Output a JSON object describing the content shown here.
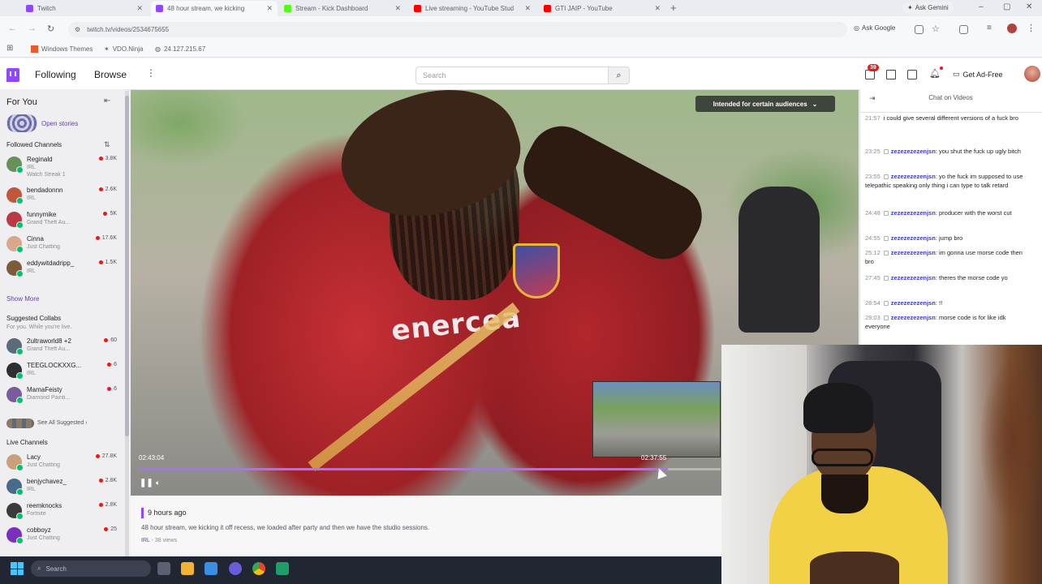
{
  "browser": {
    "tabs": [
      {
        "title": "Twitch",
        "color": "#9146ff",
        "active": false
      },
      {
        "title": "48 hour stream, we kicking",
        "color": "#9146ff",
        "active": true
      },
      {
        "title": "Stream - Kick Dashboard",
        "color": "#53fc18",
        "active": false
      },
      {
        "title": "Live streaming - YouTube Stud",
        "color": "#ff0000",
        "active": false
      },
      {
        "title": "GTI JAIP - YouTube",
        "color": "#ff0000",
        "active": false
      }
    ],
    "gemini_label": "Ask Gemini",
    "url": "twitch.tv/videos/2534675655",
    "ask_google": "Ask Google",
    "bookmarks": [
      "Windows Themes",
      "VDO.Ninja",
      "24.127.215.67"
    ]
  },
  "topnav": {
    "following": "Following",
    "browse": "Browse",
    "search_placeholder": "Search",
    "notifications_count": "39",
    "get_ad_free": "Get Ad-Free"
  },
  "sidebar": {
    "for_you": "For You",
    "open_stories": "Open stories",
    "followed_header": "Followed Channels",
    "followed": [
      {
        "name": "Reginald",
        "game": "IRL",
        "extra": "Watch Streak 1",
        "viewers": "3.8K",
        "color": "#6a8f5a"
      },
      {
        "name": "bendadonnn",
        "game": "IRL",
        "viewers": "2.6K",
        "color": "#c0563e"
      },
      {
        "name": "funnymike",
        "game": "Grand Theft Au...",
        "viewers": "5K",
        "color": "#b83a45"
      },
      {
        "name": "Cinna",
        "game": "Just Chatting",
        "viewers": "17.6K",
        "color": "#d7a98a"
      },
      {
        "name": "eddywitdadripp_",
        "game": "IRL",
        "viewers": "1.5K",
        "color": "#7d5a3a"
      }
    ],
    "show_more": "Show More",
    "suggested_header": "Suggested Collabs",
    "suggested_sub": "For you. While you're live.",
    "suggested": [
      {
        "name": "2ultraworld8 +2",
        "game": "Grand Theft Au...",
        "viewers": "60",
        "color": "#5a6b7a"
      },
      {
        "name": "TEEGLOCKXXG...",
        "game": "IRL",
        "viewers": "6",
        "color": "#2e2e33"
      },
      {
        "name": "MamaFeisty",
        "game": "Diamond Painti...",
        "viewers": "6",
        "color": "#7a5c9c"
      }
    ],
    "see_all": "See All Suggested",
    "live_header": "Live Channels",
    "live": [
      {
        "name": "Lacy",
        "game": "Just Chatting",
        "viewers": "27.8K",
        "color": "#c9a07a"
      },
      {
        "name": "benjychavez_",
        "game": "IRL",
        "viewers": "2.8K",
        "color": "#4a6a8a"
      },
      {
        "name": "reemknocks",
        "game": "Fortnite",
        "viewers": "2.8K",
        "color": "#3a3a3a"
      },
      {
        "name": "cobboyz",
        "game": "Just Chatting",
        "viewers": "25",
        "color": "#7a2fbf"
      }
    ]
  },
  "video": {
    "audience_label": "Intended for certain audiences",
    "current_time": "02:43:04",
    "hover_time": "02:37:55",
    "progress": 0.91,
    "jersey_text": "enercea"
  },
  "info": {
    "ago": "9 hours ago",
    "title": "48 hour stream, we kicking it off recess, we loaded after party and then we have the studio sessions.",
    "category": "IRL",
    "views": " - 38 views"
  },
  "chat": {
    "header": "Chat on Videos",
    "messages": [
      {
        "ts": "21:57",
        "user": "",
        "text": "i could give several different versions of a fuck bro"
      },
      {
        "ts": "23:25",
        "user": "zezezezezenjsn",
        "text": "you shut the fuck up ugly bitch"
      },
      {
        "ts": "23:55",
        "user": "zezezezezenjsn",
        "text": "yo the fuck im supposed to use telepathic speaking only thing i can type to talk retard"
      },
      {
        "ts": "24:48",
        "user": "zezezezezenjsn",
        "text": "producer with the worst cut"
      },
      {
        "ts": "24:55",
        "user": "zezezezezenjsn",
        "text": "jump bro"
      },
      {
        "ts": "25:12",
        "user": "zezezezezenjsn",
        "text": "im gonna use morse code then bro"
      },
      {
        "ts": "27:45",
        "user": "zezezezezenjsn",
        "text": "theres the morse code yo"
      },
      {
        "ts": "28:54",
        "user": "zezezezezenjsn",
        "text": "!!"
      },
      {
        "ts": "29:03",
        "user": "zezezezezenjsn",
        "text": "morse code is for like idk everyone"
      }
    ]
  },
  "taskbar": {
    "search_placeholder": "Search"
  }
}
